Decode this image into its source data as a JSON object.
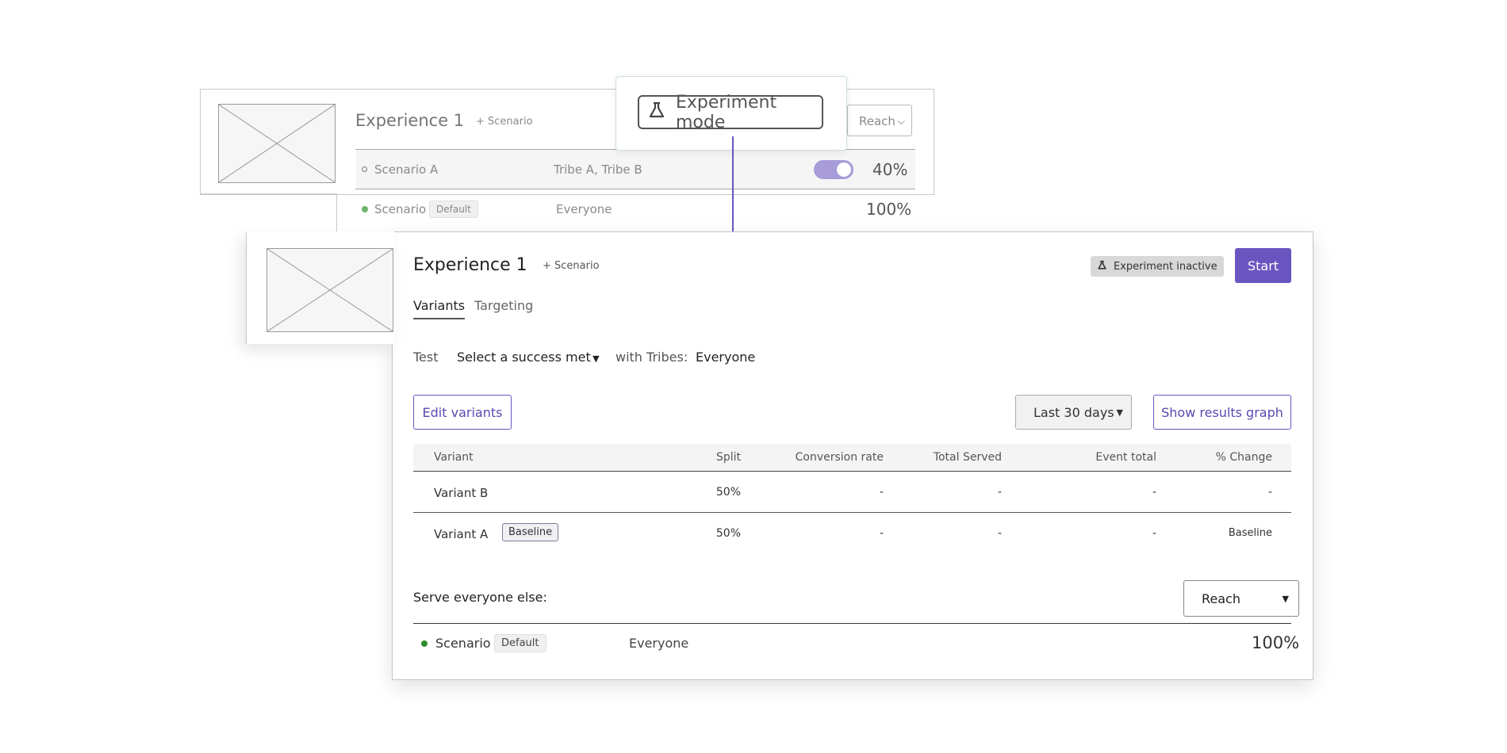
{
  "background_card": {
    "title": "Experience 1",
    "add_scenario": "+ Scenario",
    "reach_select": "Reach",
    "rows": [
      {
        "name": "Scenario A",
        "tribes": "Tribe A, Tribe B",
        "percent": "40%"
      },
      {
        "name": "Scenario",
        "badge": "Default",
        "tribes": "Everyone",
        "percent": "100%"
      }
    ]
  },
  "experiment_mode": {
    "label": "Experiment mode",
    "icon": "flask-icon"
  },
  "main": {
    "title": "Experience 1",
    "add_scenario": "+ Scenario",
    "tabs": [
      {
        "label": "Variants",
        "active": true
      },
      {
        "label": "Targeting",
        "active": false
      }
    ],
    "status_badge": "Experiment inactive",
    "start_button": "Start",
    "test_label": "Test",
    "metric_select": "Select a success metric",
    "with_tribes_label": "with Tribes:",
    "tribes_value": "Everyone",
    "edit_variants": "Edit variants",
    "date_range": "Last 30 days",
    "show_graph": "Show results graph",
    "table": {
      "columns": [
        "Variant",
        "Split",
        "Conversion rate",
        "Total Served",
        "Event total",
        "% Change"
      ],
      "rows": [
        {
          "variant": "Variant B",
          "badge": "",
          "split": "50%",
          "conversion": "-",
          "served": "-",
          "events": "-",
          "change": "-"
        },
        {
          "variant": "Variant A",
          "badge": "Baseline",
          "split": "50%",
          "conversion": "-",
          "served": "-",
          "events": "-",
          "change": "Baseline"
        }
      ]
    },
    "serve_label": "Serve everyone else:",
    "serve_select": "Reach",
    "default_row": {
      "name": "Scenario",
      "badge": "Default",
      "tribes": "Everyone",
      "percent": "100%"
    }
  },
  "colors": {
    "accent": "#6a55c0",
    "toggle": "#a79bd8",
    "active_dot": "#2e8b2e",
    "default_dot": "#6db36d"
  }
}
